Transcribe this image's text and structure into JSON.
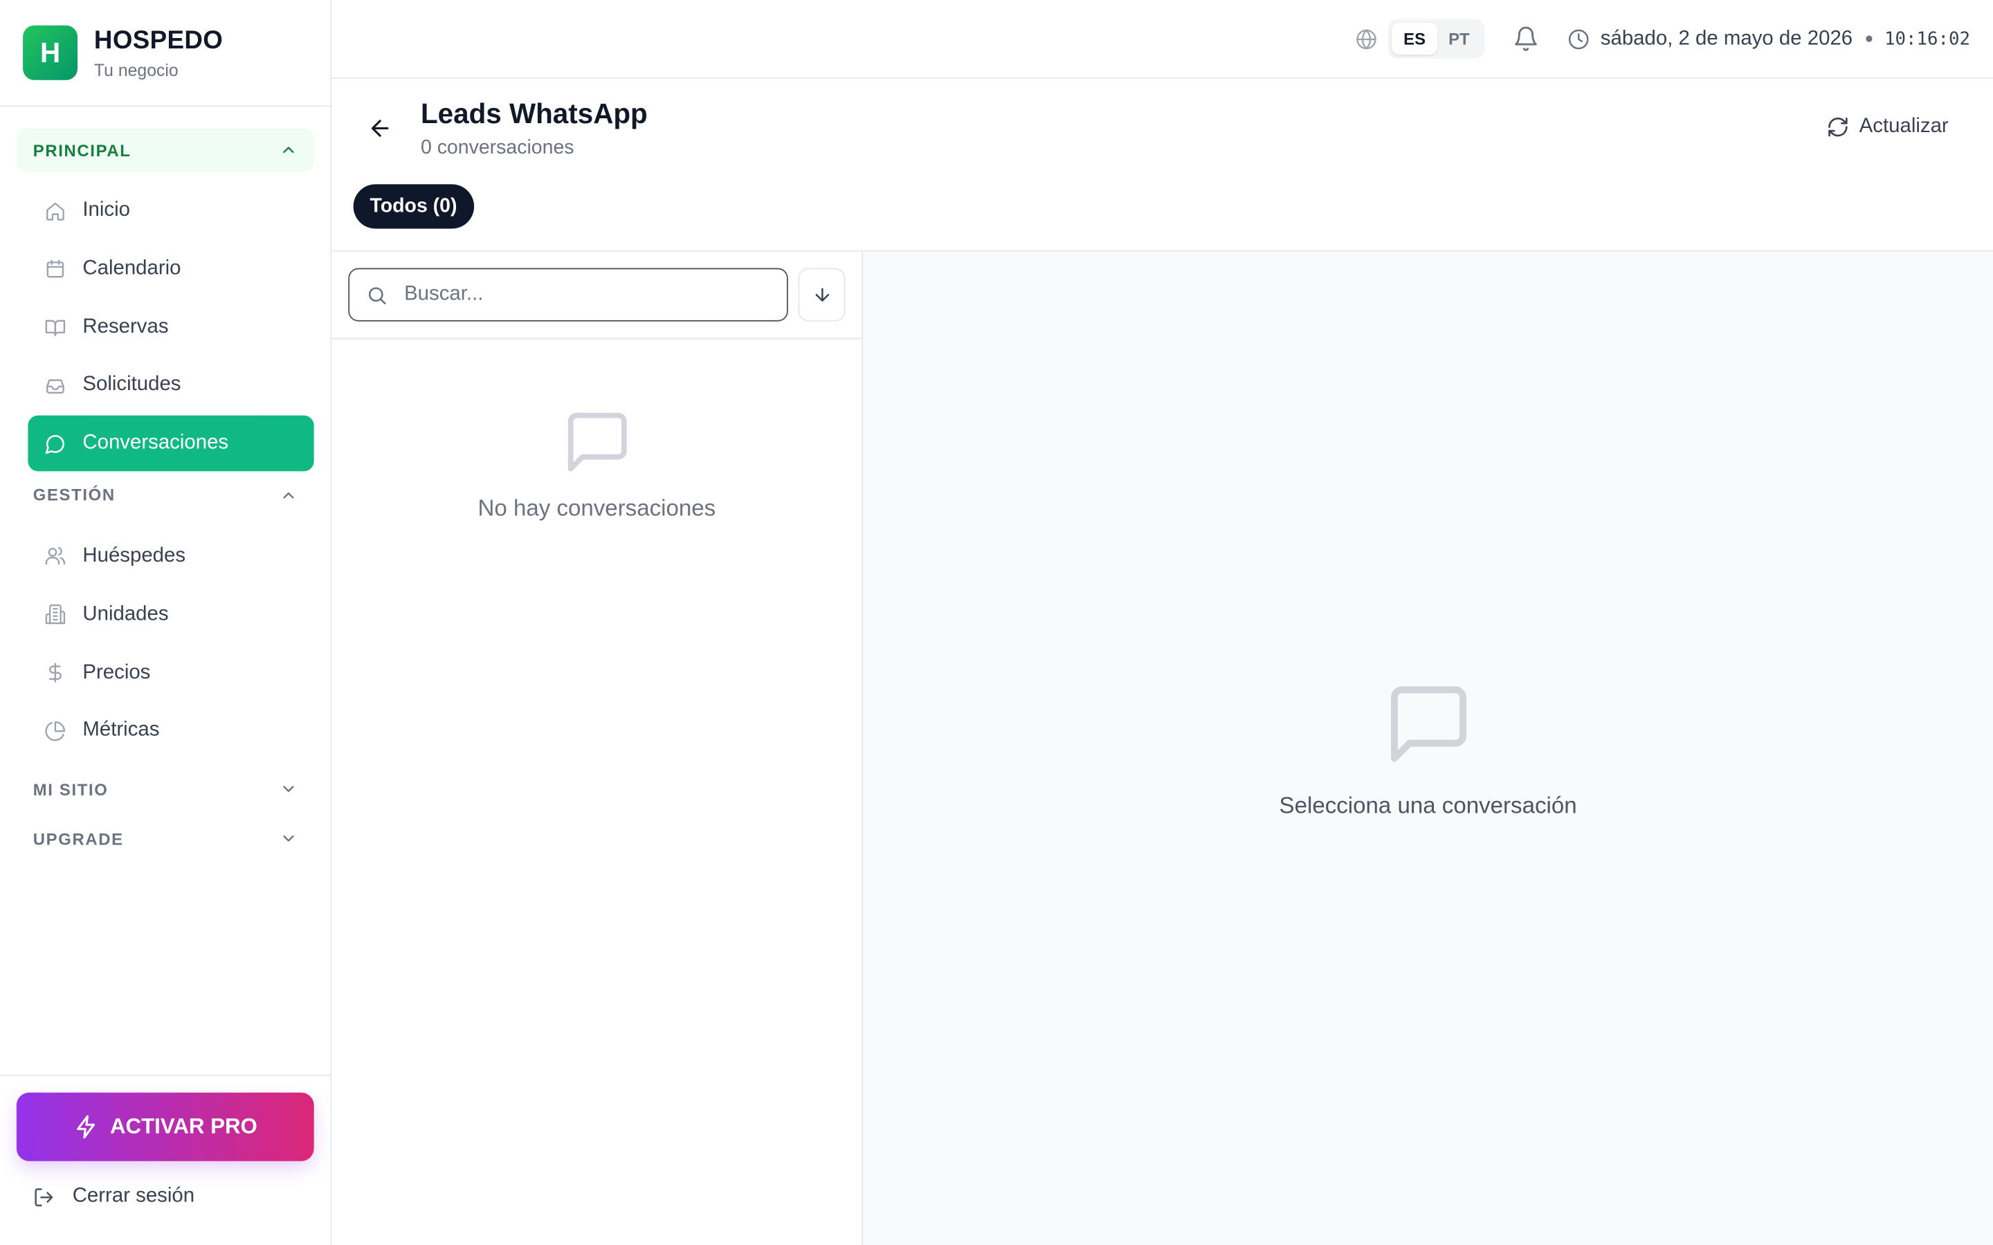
{
  "brand": {
    "initial": "H",
    "name": "HOSPEDO",
    "subtitle": "Tu negocio"
  },
  "sidebar": {
    "sections": [
      {
        "title": "PRINCIPAL",
        "expanded": true,
        "items": [
          {
            "label": "Inicio",
            "icon": "home-icon"
          },
          {
            "label": "Calendario",
            "icon": "calendar-icon"
          },
          {
            "label": "Reservas",
            "icon": "book-icon"
          },
          {
            "label": "Solicitudes",
            "icon": "inbox-icon"
          },
          {
            "label": "Conversaciones",
            "icon": "message-icon",
            "active": true
          }
        ]
      },
      {
        "title": "GESTIÓN",
        "expanded": true,
        "items": [
          {
            "label": "Huéspedes",
            "icon": "users-icon"
          },
          {
            "label": "Unidades",
            "icon": "building-icon"
          },
          {
            "label": "Precios",
            "icon": "dollar-icon"
          },
          {
            "label": "Métricas",
            "icon": "pie-chart-icon"
          }
        ]
      },
      {
        "title": "MI SITIO",
        "expanded": false,
        "items": []
      },
      {
        "title": "UPGRADE",
        "expanded": false,
        "items": []
      }
    ],
    "pro_button": "ACTIVAR PRO",
    "logout": "Cerrar sesión"
  },
  "topbar": {
    "languages": [
      "ES",
      "PT"
    ],
    "active_language": "ES",
    "date": "sábado, 2 de mayo de 2026",
    "time": "10:16:02"
  },
  "page": {
    "title": "Leads WhatsApp",
    "subtitle": "0 conversaciones",
    "refresh_label": "Actualizar",
    "filter_chip": "Todos (0)"
  },
  "list": {
    "search_placeholder": "Buscar...",
    "empty_text": "No hay conversaciones"
  },
  "detail": {
    "empty_text": "Selecciona una conversación"
  },
  "colors": {
    "accent": "#10b981",
    "pro_gradient_start": "#9333ea",
    "pro_gradient_end": "#db2777",
    "chip_bg": "#0f172a"
  }
}
